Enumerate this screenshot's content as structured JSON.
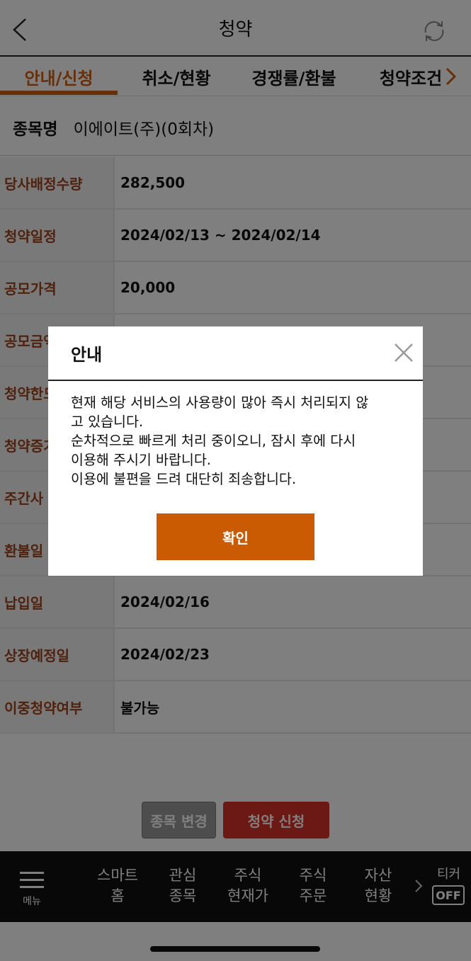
{
  "header": {
    "title": "청약"
  },
  "tabs": [
    {
      "label": "안내/신청"
    },
    {
      "label": "취소/현황"
    },
    {
      "label": "경쟁률/환불"
    },
    {
      "label": "청약조건"
    }
  ],
  "stock": {
    "label": "종목명",
    "value": "이에이트(주)(0회차)"
  },
  "info_rows": [
    {
      "label": "당사배정수량",
      "value": "282,500"
    },
    {
      "label": "청약일정",
      "value": "2024/02/13 ~ 2024/02/14"
    },
    {
      "label": "공모가격",
      "value": "20,000"
    },
    {
      "label": "공모금액",
      "value": ""
    },
    {
      "label": "청약한도",
      "value": ""
    },
    {
      "label": "청약증거금",
      "value": ""
    },
    {
      "label": "주간사",
      "value": ""
    },
    {
      "label": "환불일",
      "value": ""
    },
    {
      "label": "납입일",
      "value": "2024/02/16"
    },
    {
      "label": "상장예정일",
      "value": "2024/02/23"
    },
    {
      "label": "이중청약여부",
      "value": "불가능"
    }
  ],
  "buttons": {
    "change_stock": "종목 변경",
    "apply": "청약 신청"
  },
  "bottom_nav": {
    "menu_label": "메뉴",
    "items": [
      {
        "line1": "스마트",
        "line2": "홈"
      },
      {
        "line1": "관심",
        "line2": "종목"
      },
      {
        "line1": "주식",
        "line2": "현재가"
      },
      {
        "line1": "주식",
        "line2": "주문"
      },
      {
        "line1": "자산",
        "line2": "현황"
      }
    ],
    "ticker_label": "티커",
    "ticker_state": "OFF"
  },
  "modal": {
    "title": "안내",
    "body_lines": [
      "현재 해당 서비스의 사용량이 많아 즉시 처리되지 않",
      "고 있습니다.",
      "순차적으로 빠르게 처리 중이오니, 잠시 후에 다시",
      "이용해 주시기 바랍니다.",
      "이용에 불편을 드려 대단히 죄송합니다."
    ],
    "ok_label": "확인"
  },
  "colors": {
    "accent": "#d06010",
    "label_text": "#a0431a",
    "apply_button": "#d8322a",
    "modal_ok": "#cb5b02"
  }
}
